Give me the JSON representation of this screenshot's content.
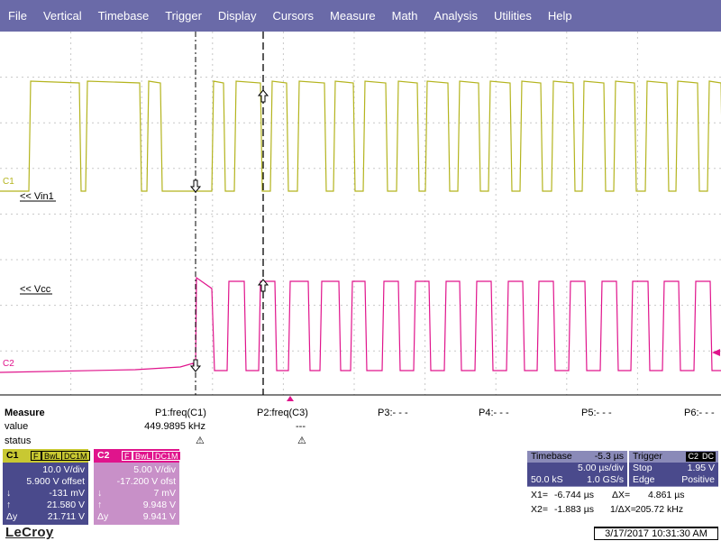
{
  "menu": {
    "items": [
      "File",
      "Vertical",
      "Timebase",
      "Trigger",
      "Display",
      "Cursors",
      "Measure",
      "Math",
      "Analysis",
      "Utilities",
      "Help"
    ]
  },
  "traces": {
    "c1": {
      "marker": "C1",
      "label": "<< Vin1",
      "color": "#b4b41e"
    },
    "c2": {
      "marker": "C2",
      "label": "<< Vcc",
      "color": "#e0148c"
    }
  },
  "measure": {
    "title": "Measure",
    "row_value": "value",
    "row_status": "status",
    "params": [
      {
        "name": "P1:freq(C1)",
        "value": "449.9895 kHz",
        "status": "⚠"
      },
      {
        "name": "P2:freq(C3)",
        "value": "---",
        "status": "⚠"
      },
      {
        "name": "P3:- - -",
        "value": "",
        "status": ""
      },
      {
        "name": "P4:- - -",
        "value": "",
        "status": ""
      },
      {
        "name": "P5:- - -",
        "value": "",
        "status": ""
      },
      {
        "name": "P6:- - -",
        "value": "",
        "status": ""
      }
    ]
  },
  "channels": {
    "c1": {
      "name": "C1",
      "tags": [
        "F",
        "BwL",
        "DC1M"
      ],
      "vdiv": "10.0 V/div",
      "offset": "5.900 V offset",
      "min_sym": "↓",
      "min": "-131 mV",
      "max_sym": "↑",
      "max": "21.580 V",
      "dy_sym": "Δy",
      "dy": "21.711 V"
    },
    "c2": {
      "name": "C2",
      "tags": [
        "F",
        "BwL",
        "DC1M"
      ],
      "vdiv": "5.00 V/div",
      "offset": "-17.200 V ofst",
      "min_sym": "↓",
      "min": "7 mV",
      "max_sym": "↑",
      "max": "9.948 V",
      "dy_sym": "Δy",
      "dy": "9.941 V"
    }
  },
  "timebase": {
    "title": "Timebase",
    "delay": "-5.3 µs",
    "tdiv": "5.00 µs/div",
    "samples": "50.0 kS",
    "rate": "1.0 GS/s"
  },
  "trigger": {
    "title": "Trigger",
    "source_tag": "C2",
    "coupling_tag": "DC",
    "mode": "Stop",
    "level": "1.95 V",
    "type": "Edge",
    "slope": "Positive"
  },
  "cursors": {
    "x1_label": "X1=",
    "x1": "-6.744 µs",
    "dx_label": "ΔX=",
    "dx": "4.861 µs",
    "x2_label": "X2=",
    "x2": "-1.883 µs",
    "inv_label": "1/ΔX=",
    "inv": "205.72 kHz"
  },
  "brand": "LeCroy",
  "datetime": "3/17/2017 10:31:30 AM"
}
